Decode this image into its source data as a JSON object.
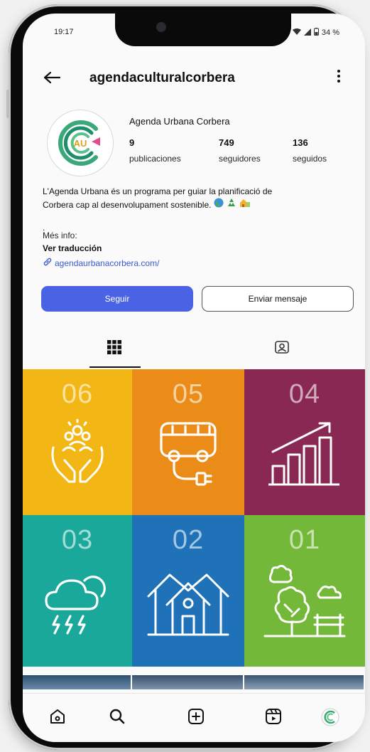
{
  "status": {
    "time": "19:17",
    "battery": "34 %"
  },
  "header": {
    "username": "agendaculturalcorbera"
  },
  "profile": {
    "avatar_text": "AU",
    "name": "Agenda Urbana Corbera",
    "stats": [
      {
        "num": "9",
        "label": "publicaciones"
      },
      {
        "num": "749",
        "label": "seguidores"
      },
      {
        "num": "136",
        "label": "seguidos"
      }
    ],
    "bio_line1": "L'Agenda Urbana és un programa per guiar la planificació de",
    "bio_line2": "Corbera cap al desenvolupament sostenible.",
    "dot": ".",
    "more_info": "Més info:",
    "translate": "Ver traducción",
    "link": "agendaurbanacorbera.com/"
  },
  "actions": {
    "follow": "Seguir",
    "message": "Enviar mensaje"
  },
  "posts": [
    {
      "number": "06",
      "color": "#f3b715",
      "icon": "community-hands-icon"
    },
    {
      "number": "05",
      "color": "#ea8c17",
      "icon": "electric-bus-icon"
    },
    {
      "number": "04",
      "color": "#8a2854",
      "icon": "growth-chart-icon"
    },
    {
      "number": "03",
      "color": "#19a89a",
      "icon": "storm-cloud-icon"
    },
    {
      "number": "02",
      "color": "#1f72b8",
      "icon": "housing-icon"
    },
    {
      "number": "01",
      "color": "#74b83a",
      "icon": "trees-park-icon"
    }
  ],
  "colors": {
    "accent": "#4a63e4",
    "link": "#3b5bcc"
  }
}
